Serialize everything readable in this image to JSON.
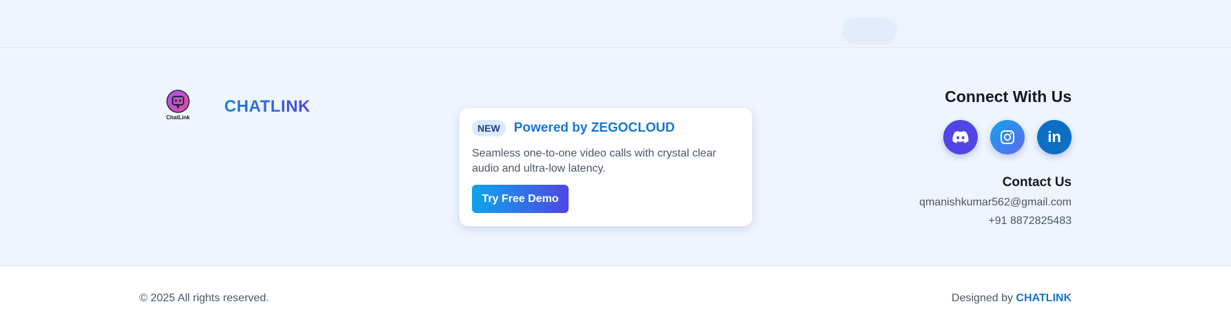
{
  "brand": {
    "name": "CHATLINK",
    "logo_caption": "ChatLink",
    "logo_icon": "robot-chat-icon"
  },
  "promo": {
    "badge": "NEW",
    "title": "Powered by ZEGOCLOUD",
    "description": "Seamless one-to-one video calls with crystal clear audio and ultra-low latency.",
    "button_label": "Try Free Demo"
  },
  "connect": {
    "title": "Connect With Us",
    "socials": [
      {
        "name": "discord",
        "icon": "discord-icon",
        "color": "#4f46e5"
      },
      {
        "name": "instagram",
        "icon": "instagram-icon",
        "color": "#0ea5e9"
      },
      {
        "name": "linkedin",
        "icon": "linkedin-icon",
        "label": "in",
        "color": "#0c6fc3"
      }
    ]
  },
  "contact": {
    "title": "Contact Us",
    "email": "qmanishkumar562@gmail.com",
    "phone": "+91 8872825483"
  },
  "bottom": {
    "copyright": "© 2025 All rights reserved.",
    "designed_by_prefix": "Designed by ",
    "designed_by_brand": "CHATLINK"
  },
  "colors": {
    "accent_blue": "#1676d2",
    "accent_indigo": "#4f46e5",
    "footer_bg": "#eef5fe"
  }
}
